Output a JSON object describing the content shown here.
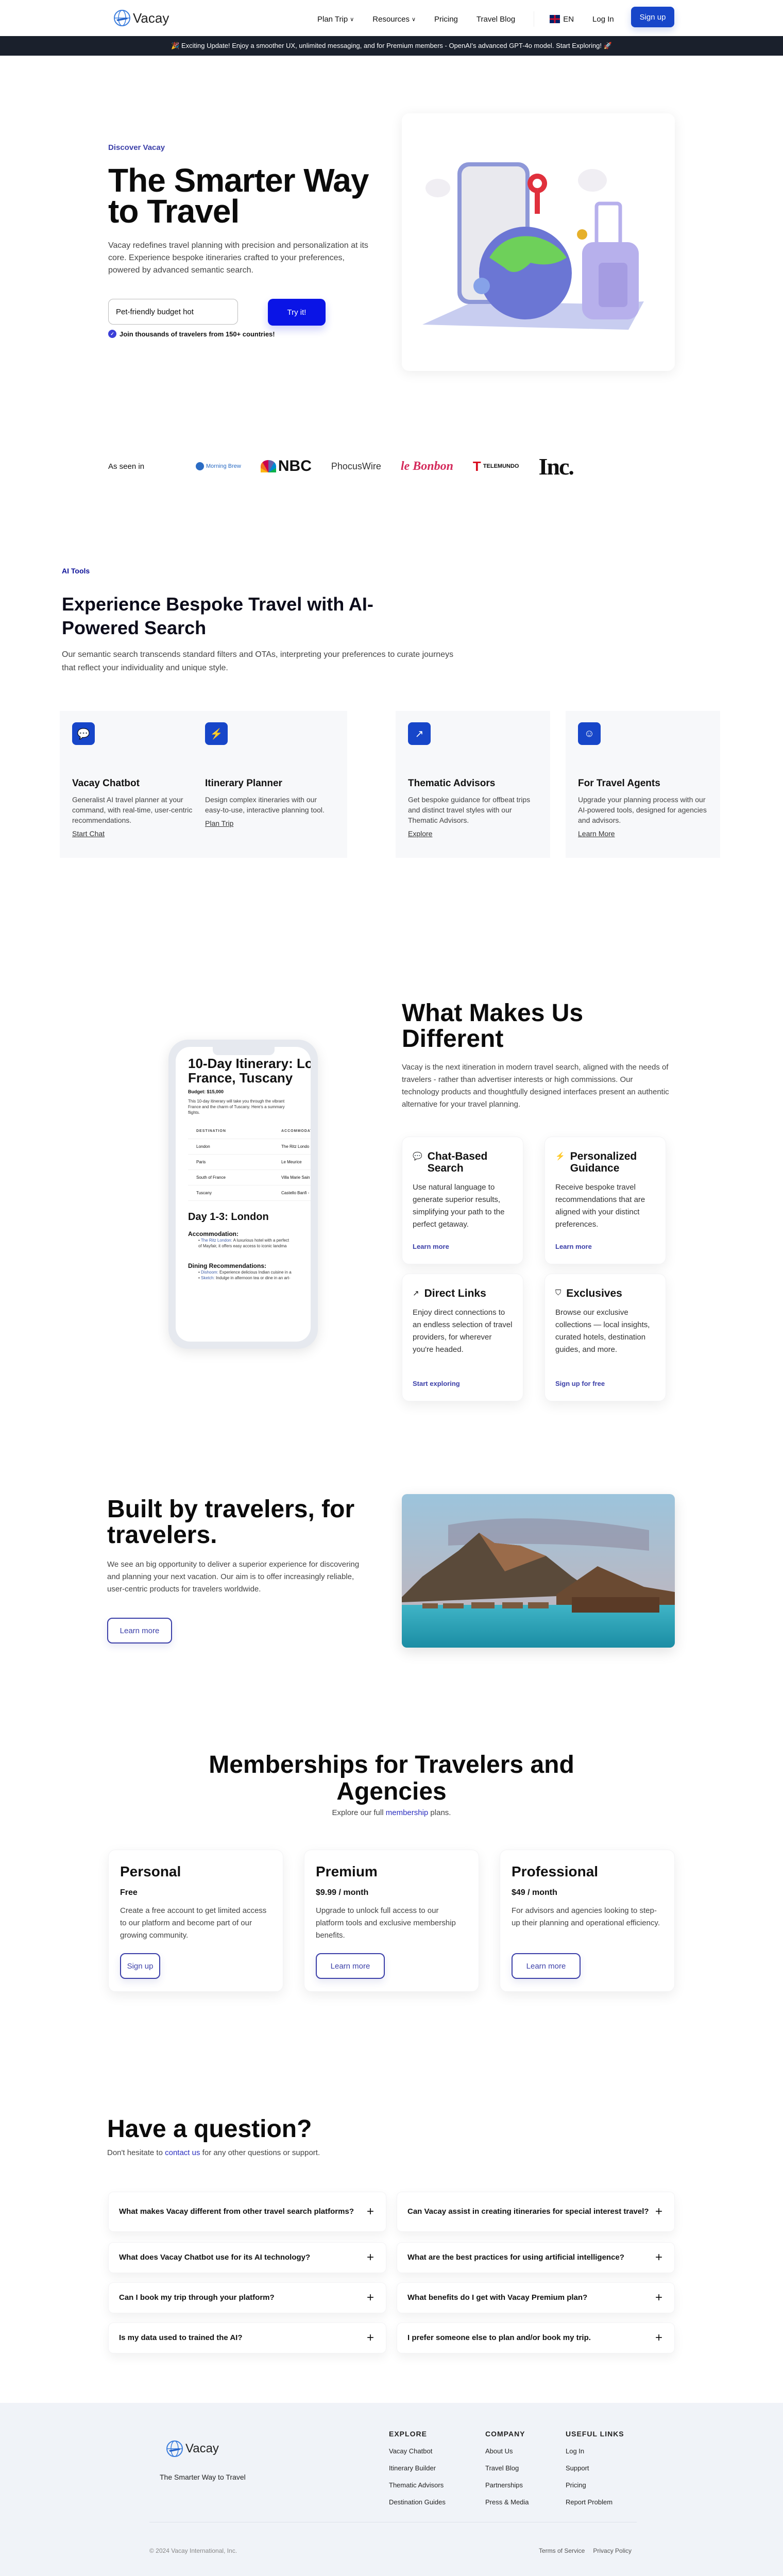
{
  "header": {
    "logo_text": "Vacay",
    "nav": [
      {
        "label": "Plan Trip",
        "has_dropdown": true
      },
      {
        "label": "Resources",
        "has_dropdown": true
      },
      {
        "label": "Pricing",
        "has_dropdown": false
      },
      {
        "label": "Travel Blog",
        "has_dropdown": false
      }
    ],
    "language": "EN",
    "login": "Log In",
    "signup": "Sign up"
  },
  "banner": {
    "text": "🎉 Exciting Update! Enjoy a smoother UX, unlimited messaging, and for Premium members - OpenAI's advanced GPT-4o model. Start Exploring! 🚀"
  },
  "hero": {
    "eyebrow": "Discover Vacay",
    "title": "The Smarter Way to Travel",
    "description": "Vacay redefines travel planning with precision and personalization at its core. Experience bespoke itineraries crafted to your preferences, powered by advanced semantic search.",
    "search_value": "Pet-friendly budget hot",
    "try_button": "Try it!",
    "join_text": "Join thousands of travelers from 150+ countries!"
  },
  "press": {
    "label": "As seen in",
    "logos": [
      "Morning Brew",
      "NBC",
      "PhocusWire",
      "le Bonbon",
      "Telemundo",
      "Inc."
    ]
  },
  "ai_tools": {
    "tag": "AI Tools",
    "title": "Experience Bespoke Travel with AI-Powered Search",
    "description": "Our semantic search transcends standard filters and OTAs, interpreting your preferences to curate journeys that reflect your individuality and unique style.",
    "cards": [
      {
        "icon": "chat-bubbles-icon",
        "title": "Vacay Chatbot",
        "desc": "Generalist AI travel planner at your command, with real-time, user-centric recommendations.",
        "link": "Start Chat"
      },
      {
        "icon": "lightning-icon",
        "title": "Itinerary Planner",
        "desc": "Design complex itineraries with our easy-to-use, interactive planning tool.",
        "link": "Plan Trip"
      },
      {
        "icon": "external-link-icon",
        "title": "Thematic Advisors",
        "desc": "Get bespoke guidance for offbeat trips and distinct travel styles with our Thematic Advisors.",
        "link": "Explore"
      },
      {
        "icon": "smiley-chat-icon",
        "title": "For Travel Agents",
        "desc": "Upgrade your planning process with our AI-powered tools, designed for agencies and advisors.",
        "link": "Learn More"
      }
    ]
  },
  "phone_itinerary": {
    "title_line1": "10-Day Itinerary: Lo",
    "title_line2": "France, Tuscany",
    "budget": "Budget: $15,000",
    "intro_line1": "This 10-day itinerary will take you through the vibrant",
    "intro_line2": "France and the charm of Tuscany. Here's a summary",
    "intro_line3": "flights.",
    "table_headers": [
      "DESTINATION",
      "ACCOMMODATI"
    ],
    "table_rows": [
      [
        "London",
        "The Ritz Londo"
      ],
      [
        "Paris",
        "Le Meurice"
      ],
      [
        "South of France",
        "Villa Marie Sain"
      ],
      [
        "Tuscany",
        "Castello Banfi -"
      ]
    ],
    "day_title": "Day 1-3: London",
    "accommodation_heading": "Accommodation:",
    "accommodation_link": "The Ritz London:",
    "accommodation_text1": " A luxurious hotel with a perfect",
    "accommodation_text2": "of Mayfair, it offers easy access to iconic landma",
    "dining_heading": "Dining Recommendations:",
    "dining": [
      {
        "name": "Dishoom:",
        "text": " Experience delicious Indian cuisine in a"
      },
      {
        "name": "Sketch:",
        "text": " Indulge in afternoon tea or dine in an art-"
      }
    ]
  },
  "different": {
    "title": "What Makes Us Different",
    "description": "Vacay is the next itineration in modern travel search, aligned with the needs of travelers - rather than advertiser interests or high commissions. Our technology products and thoughtfully designed interfaces present an authentic alternative for your travel planning.",
    "cards": [
      {
        "icon": "chat-bubbles-icon",
        "title": "Chat-Based Search",
        "desc": "Use natural language to generate superior results, simplifying your path to the perfect getaway.",
        "link": "Learn more"
      },
      {
        "icon": "lightning-icon",
        "title": "Personalized Guidance",
        "desc": "Receive bespoke travel recommendations that are aligned with your distinct preferences.",
        "link": "Learn more"
      },
      {
        "icon": "external-link-icon",
        "title": "Direct Links",
        "desc": "Enjoy direct connections to an endless selection of travel providers, for wherever you're headed.",
        "link": "Start exploring"
      },
      {
        "icon": "shield-bolt-icon",
        "title": "Exclusives",
        "desc": "Browse our exclusive collections — local insights, curated hotels, destination guides, and more.",
        "link": "Sign up for free"
      }
    ]
  },
  "built": {
    "title": "Built by travelers, for travelers.",
    "description": "We see an big opportunity to deliver a superior experience for discovering and planning your next vacation. Our aim is to offer increasingly reliable, user-centric products for travelers worldwide.",
    "button": "Learn more"
  },
  "memberships": {
    "title": "Memberships for Travelers and Agencies",
    "subtitle_pre": "Explore our full ",
    "subtitle_link": "membership",
    "subtitle_post": " plans.",
    "plans": [
      {
        "name": "Personal",
        "price": "Free",
        "desc": "Create a free account to get limited access to our platform and become part of our growing community.",
        "button": "Sign up"
      },
      {
        "name": "Premium",
        "price": "$9.99 / month",
        "desc": "Upgrade to unlock full access to our platform tools and exclusive membership benefits.",
        "button": "Learn more"
      },
      {
        "name": "Professional",
        "price": "$49 / month",
        "desc": "For advisors and agencies looking to step-up their planning and operational efficiency.",
        "button": "Learn more"
      }
    ]
  },
  "faq": {
    "title": "Have a question?",
    "subtitle_pre": "Don't hesitate to ",
    "subtitle_link": "contact us",
    "subtitle_post": " for any other questions or support.",
    "items": [
      "What makes Vacay different from other travel search platforms?",
      "Can Vacay assist in creating itineraries for special interest travel?",
      "What does Vacay Chatbot use for its AI technology?",
      "What are the best practices for using artificial intelligence?",
      "Can I book my trip through your platform?",
      "What benefits do I get with Vacay Premium plan?",
      "Is my data used to trained the AI?",
      "I prefer someone else to plan and/or book my trip."
    ]
  },
  "footer": {
    "logo_text": "Vacay",
    "tagline": "The Smarter Way to Travel",
    "columns": [
      {
        "title": "EXPLORE",
        "links": [
          "Vacay Chatbot",
          "Itinerary Builder",
          "Thematic Advisors",
          "Destination Guides"
        ]
      },
      {
        "title": "COMPANY",
        "links": [
          "About Us",
          "Travel Blog",
          "Partnerships",
          "Press & Media"
        ]
      },
      {
        "title": "USEFUL LINKS",
        "links": [
          "Log In",
          "Support",
          "Pricing",
          "Report Problem"
        ]
      }
    ],
    "copyright": "© 2024 Vacay International, Inc.",
    "legal": [
      "Terms of Service",
      "Privacy Policy"
    ]
  }
}
